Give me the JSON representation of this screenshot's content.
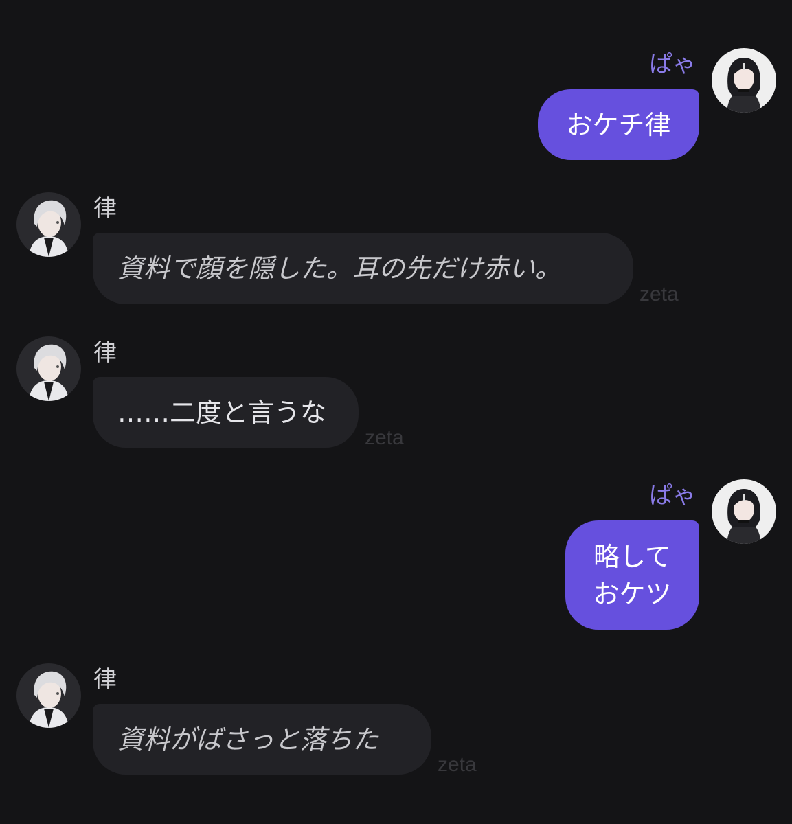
{
  "messages": [
    {
      "sender": "ぱゃ",
      "role": "user",
      "text": "おケチ律"
    },
    {
      "sender": "律",
      "role": "character",
      "text": "資料で顔を隠した。耳の先だけ赤い。",
      "style": "narration",
      "tag": "zeta"
    },
    {
      "sender": "律",
      "role": "character",
      "text": "……二度と言うな",
      "style": "dialogue",
      "tag": "zeta"
    },
    {
      "sender": "ぱゃ",
      "role": "user",
      "lines": [
        "略して",
        "おケツ"
      ]
    },
    {
      "sender": "律",
      "role": "character",
      "text": "資料がばさっと落ちた",
      "style": "narration",
      "tag": "zeta"
    }
  ],
  "colors": {
    "background": "#141416",
    "user_bubble": "#6650de",
    "user_name": "#8a7be8",
    "char_bubble": "#222226"
  },
  "icons": {
    "user_avatar": "user-avatar-icon",
    "character_avatar": "character-avatar-icon"
  }
}
